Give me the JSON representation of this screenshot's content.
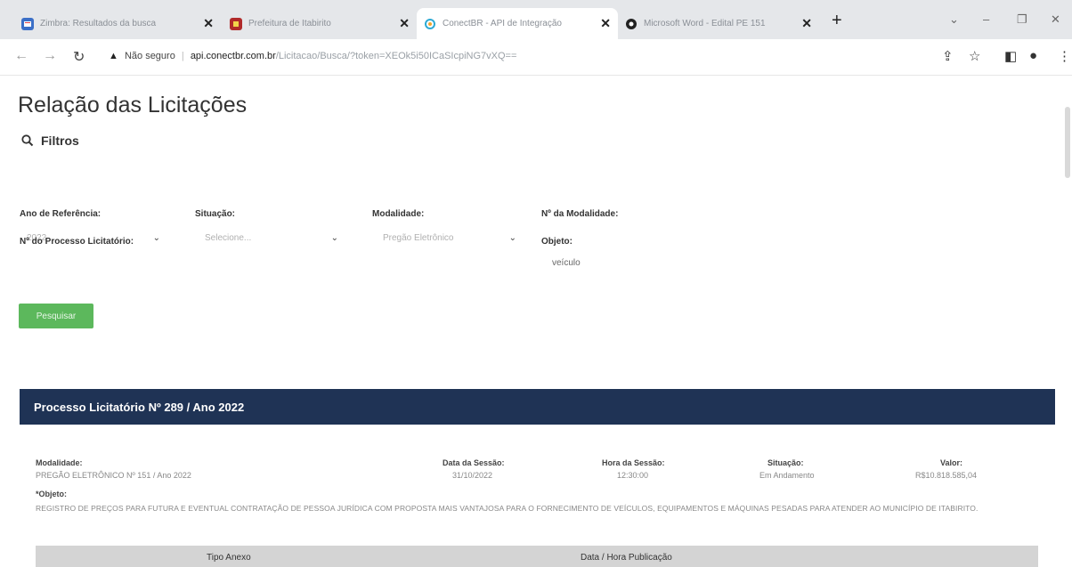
{
  "browser": {
    "tabs": [
      {
        "title": "Zimbra: Resultados da busca",
        "favicon": "zimbra-icon"
      },
      {
        "title": "Prefeitura de Itabirito",
        "favicon": "prefeitura-icon"
      },
      {
        "title": "ConectBR - API de Integração",
        "favicon": "conectbr-icon"
      },
      {
        "title": "Microsoft Word - Edital PE 151",
        "favicon": "word-icon"
      }
    ],
    "security": "Não seguro",
    "url_host": "api.conectbr.com.br",
    "url_path": "/Licitacao/Busca/?token=XEOk5i50ICaSIcpiNG7vXQ=="
  },
  "page": {
    "title": "Relação das Licitações",
    "filters_label": "Filtros"
  },
  "filters": {
    "ano": {
      "label": "Ano de Referência:",
      "value": "2022"
    },
    "situacao": {
      "label": "Situação:",
      "placeholder": "Selecione..."
    },
    "modalidade": {
      "label": "Modalidade:",
      "value": "Pregão Eletrônico"
    },
    "num_modalidade": {
      "label": "Nº da Modalidade:"
    },
    "num_processo": {
      "label": "Nº do Processo Licitatório:"
    },
    "objeto": {
      "label": "Objeto:",
      "value": "veículo"
    }
  },
  "search_button": "Pesquisar",
  "result": {
    "header": "Processo Licitatório Nº 289 / Ano 2022",
    "modalidade_label": "Modalidade:",
    "modalidade_value": "PREGÃO ELETRÔNICO Nº 151 / Ano 2022",
    "data_label": "Data da Sessão:",
    "data_value": "31/10/2022",
    "hora_label": "Hora da Sessão:",
    "hora_value": "12:30:00",
    "situacao_label": "Situação:",
    "situacao_value": "Em Andamento",
    "valor_label": "Valor:",
    "valor_value": "R$10.818.585,04",
    "objeto_label": "*Objeto:",
    "objeto_text": "REGISTRO DE PREÇOS PARA FUTURA E EVENTUAL CONTRATAÇÃO DE PESSOA JURÍDICA COM PROPOSTA MAIS VANTAJOSA PARA O FORNECIMENTO DE VEÍCULOS, EQUIPAMENTOS E MÁQUINAS PESADAS PARA ATENDER AO MUNICÍPIO DE ITABIRITO.",
    "annex_columns": [
      "Tipo Anexo",
      "Data / Hora Publicação"
    ]
  },
  "colors": {
    "header_bg": "#1f3355",
    "button_bg": "#5cb85c"
  }
}
